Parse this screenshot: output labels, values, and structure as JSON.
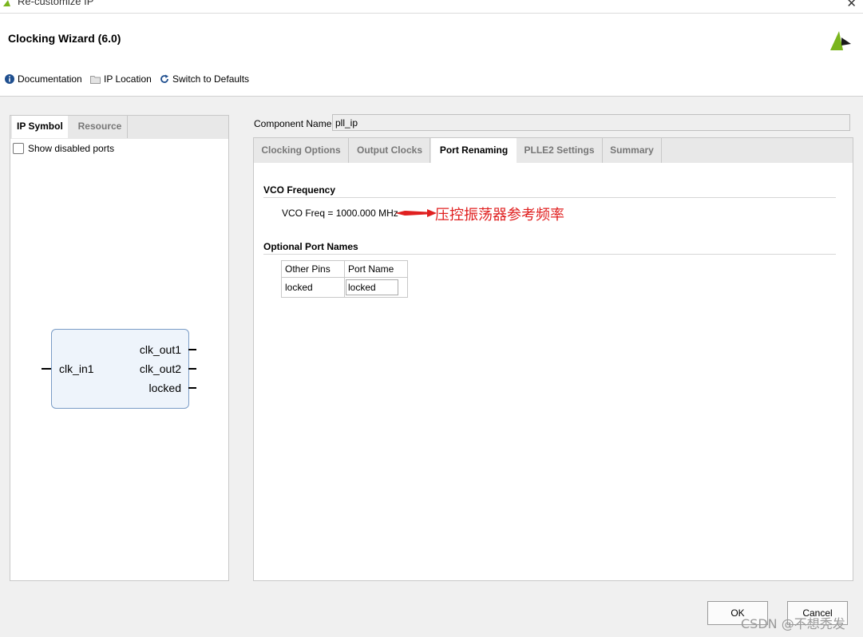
{
  "window": {
    "title": "Re-customize IP",
    "close_glyph": "✕"
  },
  "header": {
    "wizard_title": "Clocking Wizard (6.0)"
  },
  "toolbar": {
    "documentation": "Documentation",
    "ip_location": "IP Location",
    "switch_defaults": "Switch to Defaults"
  },
  "left_panel": {
    "tabs": [
      "IP Symbol",
      "Resource"
    ],
    "show_disabled": "Show disabled ports",
    "symbol": {
      "inputs": [
        "clk_in1"
      ],
      "outputs": [
        "clk_out1",
        "clk_out2",
        "locked"
      ]
    }
  },
  "component": {
    "label": "Component Name",
    "value": "pll_ip"
  },
  "right_panel": {
    "tabs": [
      "Clocking Options",
      "Output Clocks",
      "Port Renaming",
      "PLLE2 Settings",
      "Summary"
    ],
    "active_tab": "Port Renaming",
    "vco_section": "VCO Frequency",
    "vco_text": "VCO Freq = 1000.000 MHz",
    "annotation": "压控振荡器参考频率",
    "port_section": "Optional Port Names",
    "table": {
      "headers": [
        "Other Pins",
        "Port Name"
      ],
      "rows": [
        [
          "locked",
          "locked"
        ]
      ]
    }
  },
  "buttons": {
    "ok": "OK",
    "cancel": "Cancel"
  },
  "watermark": "CSDN @不想秃发",
  "colors": {
    "accent_blue": "#1f5fa8",
    "annotation_red": "#e02020",
    "logo_green": "#7ab51d"
  }
}
